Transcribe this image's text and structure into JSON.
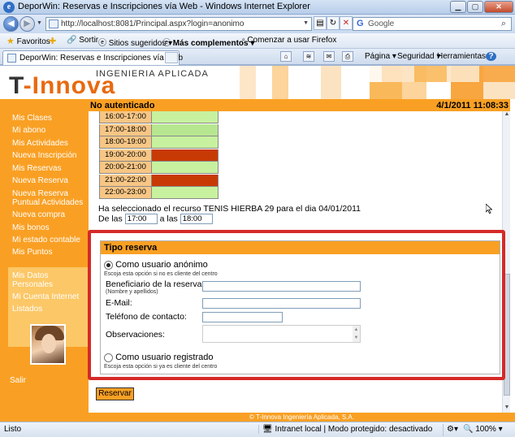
{
  "window": {
    "title": "DeporWin: Reservas e Inscripciones vía Web - Windows Internet Explorer",
    "controls": [
      "minimize",
      "maximize",
      "close"
    ]
  },
  "address": {
    "url": "http://localhost:8081/Principal.aspx?login=anonimo",
    "search_placeholder": "Google"
  },
  "favorites_bar": {
    "favorites_label": "Favoritos",
    "items": [
      "Sortir",
      "Sitios sugeridos ▾",
      "Más complementos ▾",
      "Comenzar a usar Firefox"
    ]
  },
  "tabs": [
    {
      "label": "DeporWin: Reservas e Inscripciones vía Web"
    }
  ],
  "command_bar": {
    "page": "Página ▾",
    "safety": "Seguridad ▾",
    "tools": "Herramientas ▾",
    "help": "?"
  },
  "brand": {
    "logo_prefix": "T",
    "logo_suffix": "-Innova",
    "tagline": "INGENIERIA APLICADA",
    "primary_color": "#f9a024",
    "accent_color": "#d52a28"
  },
  "header": {
    "auth_status": "No autenticado",
    "datetime": "4/1/2011 11:08:33"
  },
  "sidebar": {
    "menu": [
      "Mis Clases",
      "Mi abono",
      "Mis Actividades",
      "Nueva Inscripción",
      "Mis Reservas",
      "Nueva Reserva",
      "Nueva Reserva Puntual Actividades",
      "Nueva compra",
      "Mis bonos",
      "Mi estado contable",
      "Mis Puntos"
    ],
    "user_menu": [
      "Mis Datos Personales",
      "Mi Cuenta Internet",
      "Listados"
    ],
    "logout": "Salir"
  },
  "schedule": {
    "slots": [
      {
        "time": "16:00-17:00",
        "state": "free"
      },
      {
        "time": "17:00-18:00",
        "state": "selected"
      },
      {
        "time": "18:00-19:00",
        "state": "free"
      },
      {
        "time": "19:00-20:00",
        "state": "busy"
      },
      {
        "time": "20:00-21:00",
        "state": "free"
      },
      {
        "time": "21:00-22:00",
        "state": "busy"
      },
      {
        "time": "22:00-23:00",
        "state": "free"
      }
    ],
    "selection_text": "Ha seleccionado el recurso TENIS HIERBA 29 para el dia 04/01/2011",
    "from_label": "De las",
    "from_value": "17:00",
    "to_label": "a las",
    "to_value": "18:00"
  },
  "reservation_type": {
    "heading": "Tipo reserva",
    "anonymous_label": "Como usuario anónimo",
    "anonymous_note": "Escoja esta opción si no es cliente del centro",
    "beneficiary_label": "Beneficiario de la reserva:",
    "beneficiary_hint": "(Nombre y apellidos)",
    "email_label": "E-Mail:",
    "phone_label": "Teléfono de contacto:",
    "notes_label": "Observaciones:",
    "registered_label": "Como usuario registrado",
    "registered_note": "Escoja esta opción si ya es cliente del centro",
    "selected_option": "anonymous"
  },
  "actions": {
    "submit": "Reservar"
  },
  "footer": {
    "text": "© T-Innova Ingeniería Aplicada, S.A."
  },
  "statusbar": {
    "status": "Listo",
    "zone": "Intranet local | Modo protegido: desactivado",
    "zoom": "100%"
  }
}
